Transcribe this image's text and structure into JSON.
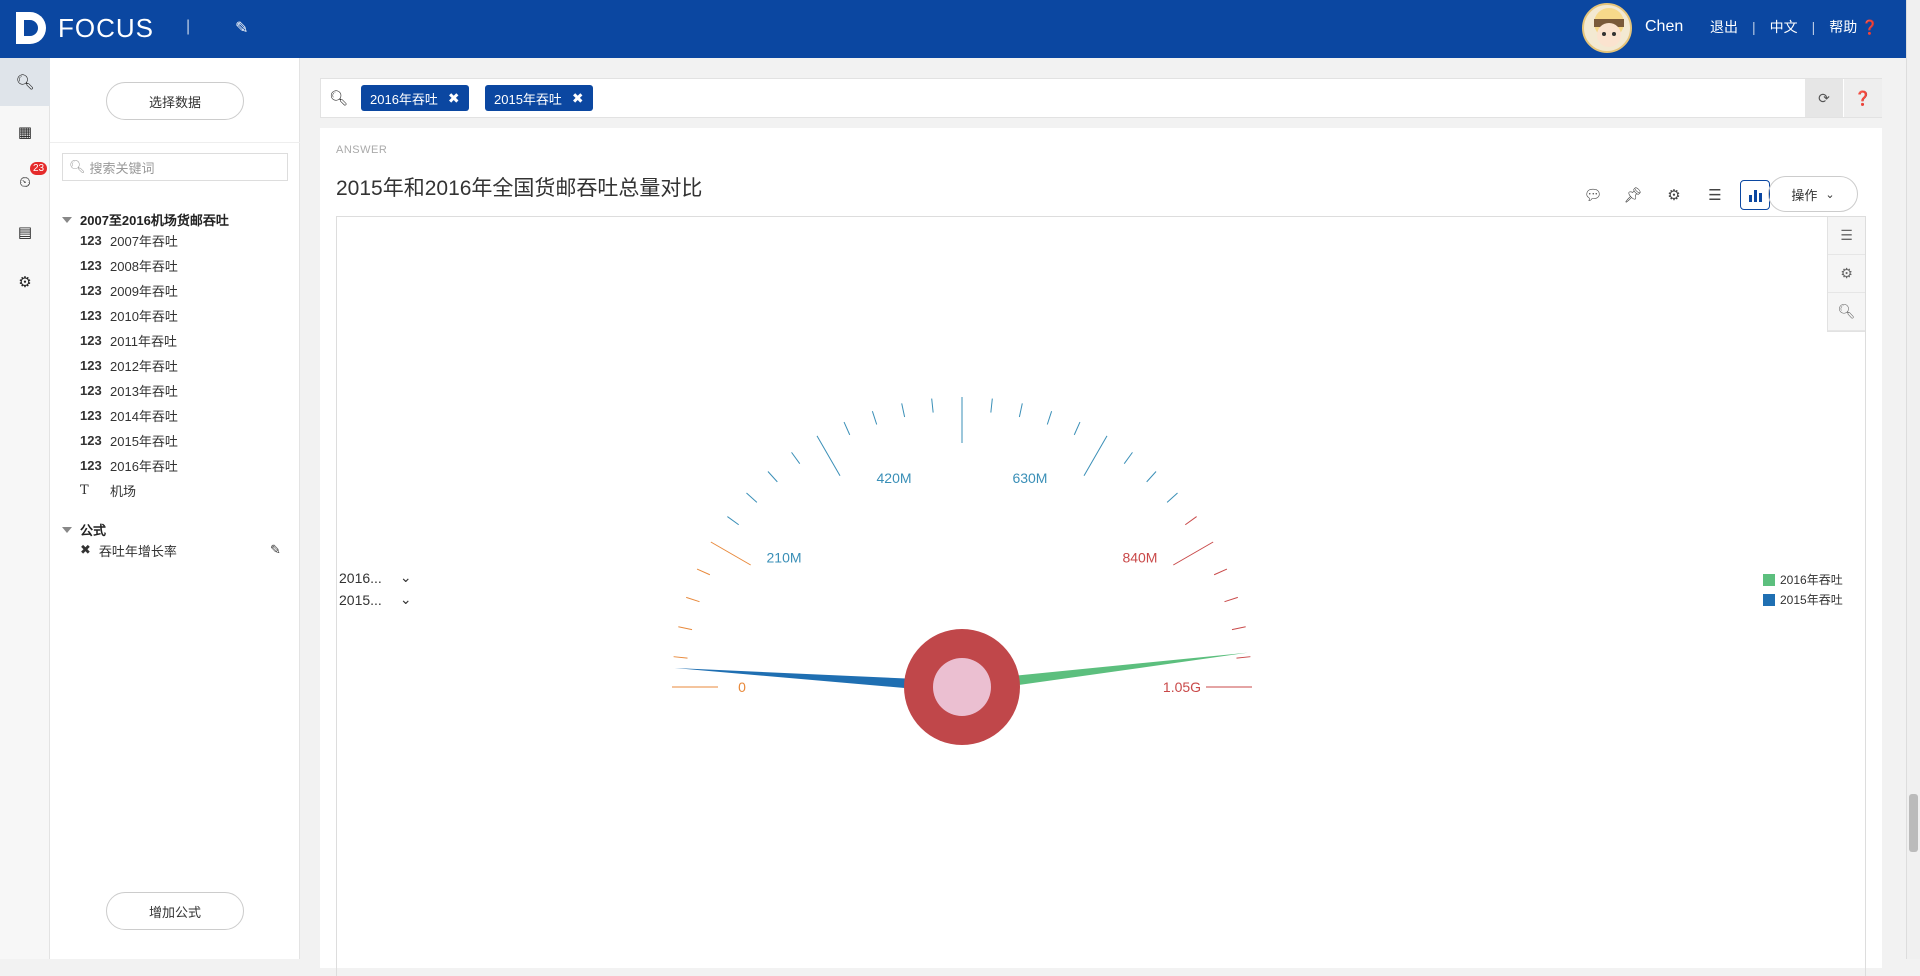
{
  "app": {
    "brand": "FOCUS",
    "username": "Chen",
    "links": [
      "退出",
      "中文",
      "帮助"
    ]
  },
  "rail": {
    "badge_count": "23"
  },
  "left_panel": {
    "select_data_label": "选择数据",
    "search_placeholder": "搜索关键词",
    "dataset_name": "2007至2016机场货邮吞吐",
    "fields": [
      {
        "type": "123",
        "name": "2007年吞吐"
      },
      {
        "type": "123",
        "name": "2008年吞吐"
      },
      {
        "type": "123",
        "name": "2009年吞吐"
      },
      {
        "type": "123",
        "name": "2010年吞吐"
      },
      {
        "type": "123",
        "name": "2011年吞吐"
      },
      {
        "type": "123",
        "name": "2012年吞吐"
      },
      {
        "type": "123",
        "name": "2013年吞吐"
      },
      {
        "type": "123",
        "name": "2014年吞吐"
      },
      {
        "type": "123",
        "name": "2015年吞吐"
      },
      {
        "type": "123",
        "name": "2016年吞吐"
      },
      {
        "type": "T",
        "name": "机场"
      }
    ],
    "formula_header": "公式",
    "formula_item": "吞吐年增长率",
    "add_formula_label": "增加公式"
  },
  "search": {
    "chips": [
      "2016年吞吐",
      "2015年吞吐"
    ]
  },
  "answer": {
    "label": "ANSWER",
    "title": "2015年和2016年全国货邮吞吐总量对比",
    "ops_label": "操作",
    "series_selectors": [
      "2016...",
      "2015..."
    ]
  },
  "chart_data": {
    "type": "gauge",
    "min": 0,
    "max": 1050000000,
    "tick_labels": [
      "0",
      "210M",
      "420M",
      "630M",
      "840M",
      "1.05G"
    ],
    "series": [
      {
        "name": "2016年吞吐",
        "value": 1010000000,
        "color": "#5cbf7e"
      },
      {
        "name": "2015年吞吐",
        "value": 22000000,
        "color": "#1f6fb2"
      }
    ],
    "band_colors": [
      "#e8893b",
      "#3a8fb7",
      "#c94949"
    ],
    "legend": "right",
    "center_outer_color": "#c0474a",
    "center_inner_color": "#ebbfd1"
  }
}
